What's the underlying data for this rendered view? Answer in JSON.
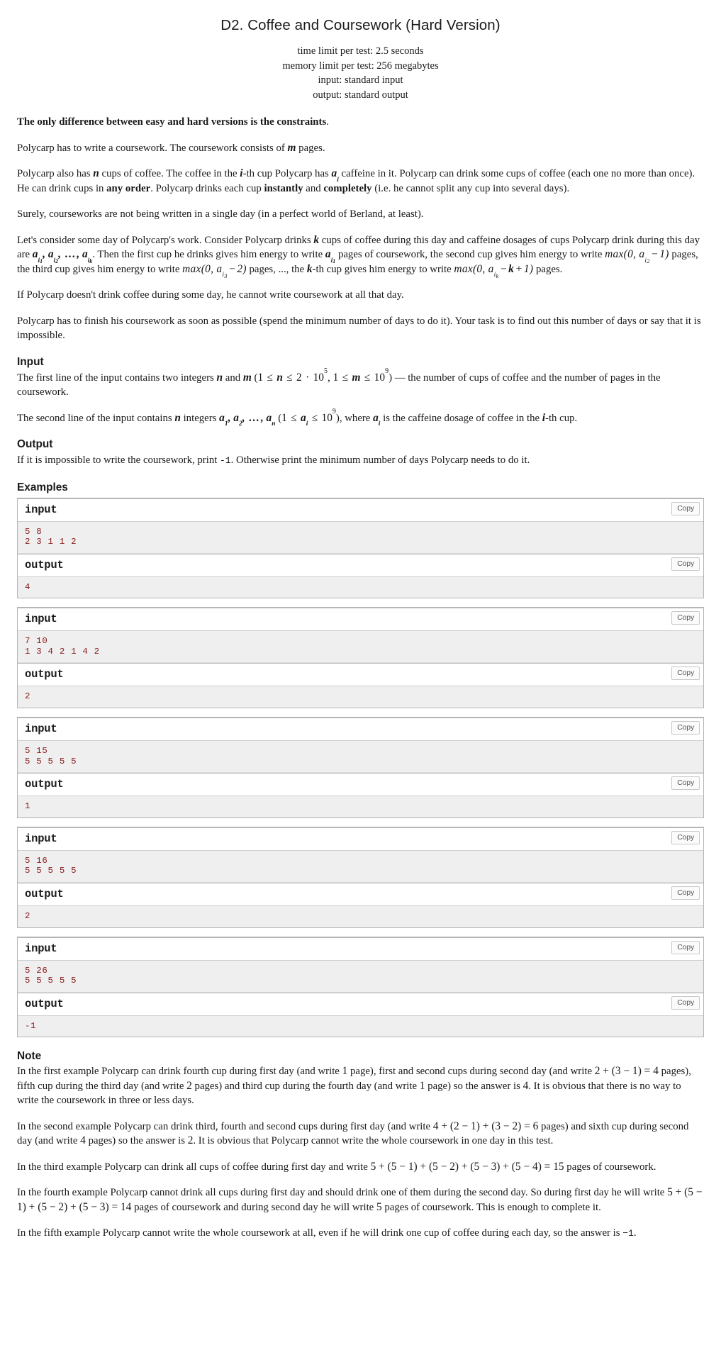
{
  "header": {
    "title": "D2. Coffee and Coursework (Hard Version)",
    "time_limit": "time limit per test: 2.5 seconds",
    "memory_limit": "memory limit per test: 256 megabytes",
    "input_file": "input: standard input",
    "output_file": "output: standard output"
  },
  "statement": {
    "difference_note_bold": "The only difference between easy and hard versions is the constraints",
    "difference_note_tail": ".",
    "p1_a": "Polycarp has to write a coursework. The coursework consists of ",
    "p1_m": "m",
    "p1_b": " pages.",
    "p2_a": "Polycarp also has ",
    "p2_n": "n",
    "p2_b": " cups of coffee. The coffee in the ",
    "p2_i": "i",
    "p2_c": "-th cup Polycarp has ",
    "p2_a_i": "a",
    "p2_a_i_sub": "i",
    "p2_d": " caffeine in it. Polycarp can drink some cups of coffee (each one no more than once). He can drink cups in ",
    "p2_bold1": "any order",
    "p2_e": ". Polycarp drinks each cup ",
    "p2_bold2": "instantly",
    "p2_f": " and ",
    "p2_bold3": "completely",
    "p2_g": " (i.e. he cannot split any cup into several days).",
    "p3": "Surely, courseworks are not being written in a single day (in a perfect world of Berland, at least).",
    "p4_a": "Let's consider some day of Polycarp's work. Consider Polycarp drinks ",
    "p4_k": "k",
    "p4_b": " cups of coffee during this day and caffeine dosages of cups Polycarp drink during this day are ",
    "p4_seq": "a",
    "p4_c": ". Then the first cup he drinks gives him energy to write ",
    "p4_d": " pages of coursework, the second cup gives him energy to write ",
    "p4_e": " pages, the third cup gives him energy to write ",
    "p4_f": " pages, ..., the ",
    "p4_g": "-th cup gives him energy to write ",
    "p4_h": " pages.",
    "p5": "If Polycarp doesn't drink coffee during some day, he cannot write coursework at all that day.",
    "p6": "Polycarp has to finish his coursework as soon as possible (spend the minimum number of days to do it). Your task is to find out this number of days or say that it is impossible."
  },
  "input_section": {
    "heading": "Input",
    "p1_a": "The first line of the input contains two integers ",
    "p1_n": "n",
    "p1_and": " and ",
    "p1_m": "m",
    "p1_b": " (",
    "p1_c": ") — the number of cups of coffee and the number of pages in the coursework.",
    "p2_a": "The second line of the input contains ",
    "p2_n": "n",
    "p2_b": " integers ",
    "p2_c": " (",
    "p2_d": "), where ",
    "p2_e": " is the caffeine dosage of coffee in the ",
    "p2_f": "-th cup."
  },
  "output_section": {
    "heading": "Output",
    "p1_a": "If it is impossible to write the coursework, print ",
    "p1_code": "-1",
    "p1_b": ". Otherwise print the minimum number of days Polycarp needs to do it."
  },
  "examples": {
    "heading": "Examples",
    "input_label": "input",
    "output_label": "output",
    "copy_label": "Copy",
    "tests": [
      {
        "input": "5 8\n2 3 1 1 2",
        "output": "4"
      },
      {
        "input": "7 10\n1 3 4 2 1 4 2",
        "output": "2"
      },
      {
        "input": "5 15\n5 5 5 5 5",
        "output": "1"
      },
      {
        "input": "5 16\n5 5 5 5 5",
        "output": "2"
      },
      {
        "input": "5 26\n5 5 5 5 5",
        "output": "-1"
      }
    ]
  },
  "note_section": {
    "heading": "Note",
    "n1_a": "In the first example Polycarp can drink fourth cup during first day (and write ",
    "n1_one": "1",
    "n1_b": " page), first and second cups during second day (and write ",
    "n1_eq": "2 + (3 − 1) = 4",
    "n1_c": " pages), fifth cup during the third day (and write ",
    "n1_two": "2",
    "n1_d": " pages) and third cup during the fourth day (and write ",
    "n1_one2": "1",
    "n1_e": " page) so the answer is ",
    "n1_four": "4",
    "n1_f": ". It is obvious that there is no way to write the coursework in three or less days.",
    "n2_a": "In the second example Polycarp can drink third, fourth and second cups during first day (and write ",
    "n2_eq": "4 + (2 − 1) + (3 − 2) = 6",
    "n2_b": " pages) and sixth cup during second day (and write ",
    "n2_four": "4",
    "n2_c": " pages) so the answer is ",
    "n2_two": "2",
    "n2_d": ". It is obvious that Polycarp cannot write the whole coursework in one day in this test.",
    "n3_a": "In the third example Polycarp can drink all cups of coffee during first day and write ",
    "n3_eq": "5 + (5 − 1) + (5 − 2) + (5 − 3) + (5 − 4) = 15",
    "n3_b": " pages of coursework.",
    "n4_a": "In the fourth example Polycarp cannot drink all cups during first day and should drink one of them during the second day. So during first day he will write ",
    "n4_eq": "5 + (5 − 1) + (5 − 2) + (5 − 3) = 14",
    "n4_b": " pages of coursework and during second day he will write ",
    "n4_five": "5",
    "n4_c": " pages of coursework. This is enough to complete it.",
    "n5_a": "In the fifth example Polycarp cannot write the whole coursework at all, even if he will drink one cup of coffee during each day, so the answer is ",
    "n5_neg": "−1",
    "n5_b": "."
  },
  "colors": {
    "test_data_text": "#8b2020",
    "test_data_bg": "#efefef",
    "border": "#b5b5b5",
    "text": "#181818"
  }
}
